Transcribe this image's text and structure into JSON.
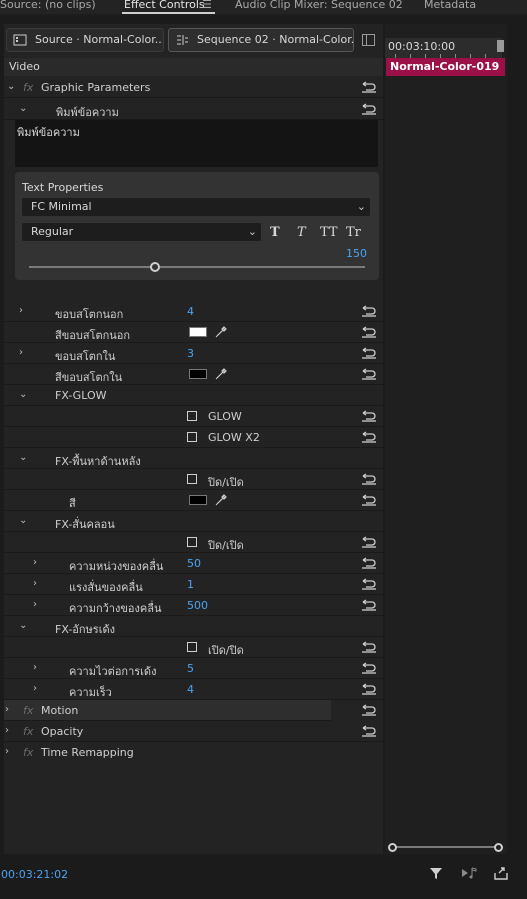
{
  "tabs": {
    "source": "Source: (no clips)",
    "effect_controls": "Effect Controls",
    "audio_mixer": "Audio Clip Mixer: Sequence 02",
    "metadata": "Metadata"
  },
  "subtabs": {
    "source_clip": "Source · Normal-Color...",
    "sequence_clip": "Sequence 02 · Normal-Color..."
  },
  "timeline": {
    "timecode": "00:03:10:00",
    "clip_name": "Normal-Color-019",
    "clip_color": "#9b1046"
  },
  "video_header": "Video",
  "graphic_parameters": "Graphic Parameters",
  "text_layer_label": "พิมพ์ข้อความ",
  "text_value": "พิมพ์ข้อความ",
  "text_properties": {
    "title": "Text Properties",
    "font": "FC Minimal",
    "style": "Regular",
    "style_buttons": [
      "T",
      "T",
      "TT",
      "Tr"
    ],
    "size": "150"
  },
  "props": {
    "outer_stroke": {
      "label": "ขอบสโตกนอก",
      "value": "4"
    },
    "outer_stroke_color": {
      "label": "สีขอบสโตกนอก",
      "color": "#ffffff"
    },
    "inner_stroke": {
      "label": "ขอบสโตกใน",
      "value": "3"
    },
    "inner_stroke_color": {
      "label": "สีขอบสโตกใน",
      "color": "#000000"
    },
    "fx_glow": "FX-GLOW",
    "glow": "GLOW",
    "glow_x2": "GLOW X2",
    "fx_bg": "FX-พื้นหาด้านหลัง",
    "bg_toggle": "ปิด/เปิด",
    "bg_color": {
      "label": "สี",
      "color": "#000000"
    },
    "fx_shake": "FX-สั่นคลอน",
    "shake_toggle": "ปิด/เปิด",
    "wave_delay": {
      "label": "ความหน่วงของคลื่น",
      "value": "50"
    },
    "wave_strength": {
      "label": "แรงสั่นของคลื่น",
      "value": "1"
    },
    "wave_width": {
      "label": "ความกว้างของคลื่น",
      "value": "500"
    },
    "fx_bounce": "FX-อักษรเด้ง",
    "bounce_toggle": "เปิด/ปิด",
    "bounce_delay": {
      "label": "ความไวต่อการเด้ง",
      "value": "5"
    },
    "speed": {
      "label": "ความเร็ว",
      "value": "4"
    }
  },
  "effects": {
    "motion": "Motion",
    "opacity": "Opacity",
    "time_remapping": "Time Remapping"
  },
  "bottom": {
    "timecode": "00:03:21:02"
  }
}
